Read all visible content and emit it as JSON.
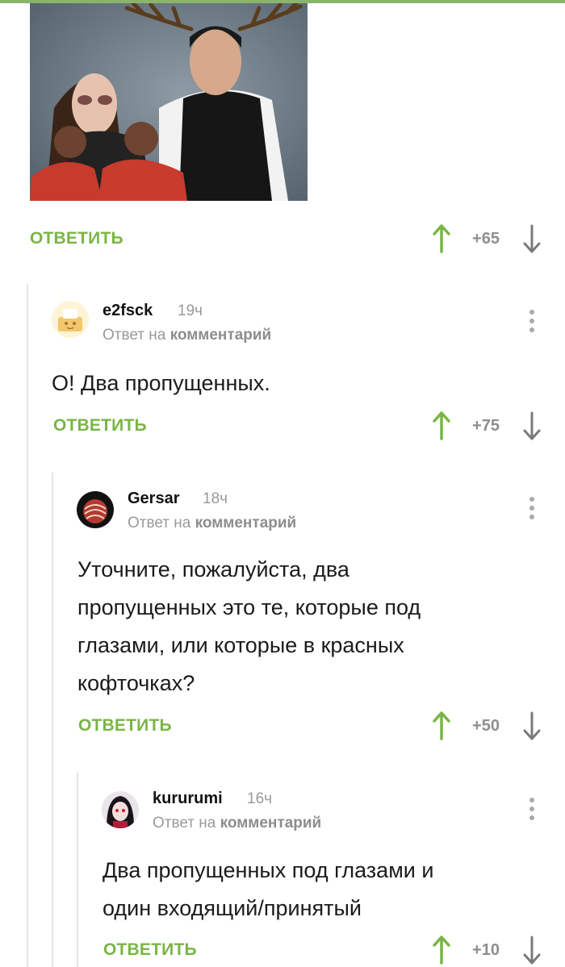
{
  "post": {
    "reply_label": "ОТВЕТИТЬ",
    "score": "+65"
  },
  "comments": [
    {
      "user": "e2fsck",
      "time": "19ч",
      "reply_prefix": "Ответ на",
      "reply_target": "комментарий",
      "text": "О! Два пропущенных.",
      "reply_label": "ОТВЕТИТЬ",
      "score": "+75"
    },
    {
      "user": "Gersar",
      "time": "18ч",
      "reply_prefix": "Ответ на",
      "reply_target": "комментарий",
      "text_lines": [
        "Уточните, пожалуйста, два",
        "пропущенных это те, которые под",
        "глазами, или которые в красных",
        "кофточках?"
      ],
      "reply_label": "ОТВЕТИТЬ",
      "score": "+50"
    },
    {
      "user": "kururumi",
      "time": "16ч",
      "reply_prefix": "Ответ на",
      "reply_target": "комментарий",
      "text_lines": [
        "Два пропущенных под глазами и",
        "один входящий/принятый"
      ],
      "reply_label": "ОТВЕТИТЬ",
      "score": "+10"
    }
  ],
  "colors": {
    "accent_green": "#7ab547",
    "muted_gray": "#9a9a9a",
    "thread_line": "#e5e5e5"
  },
  "icons": [
    "vote-up-icon",
    "vote-down-icon",
    "more-options-icon"
  ]
}
